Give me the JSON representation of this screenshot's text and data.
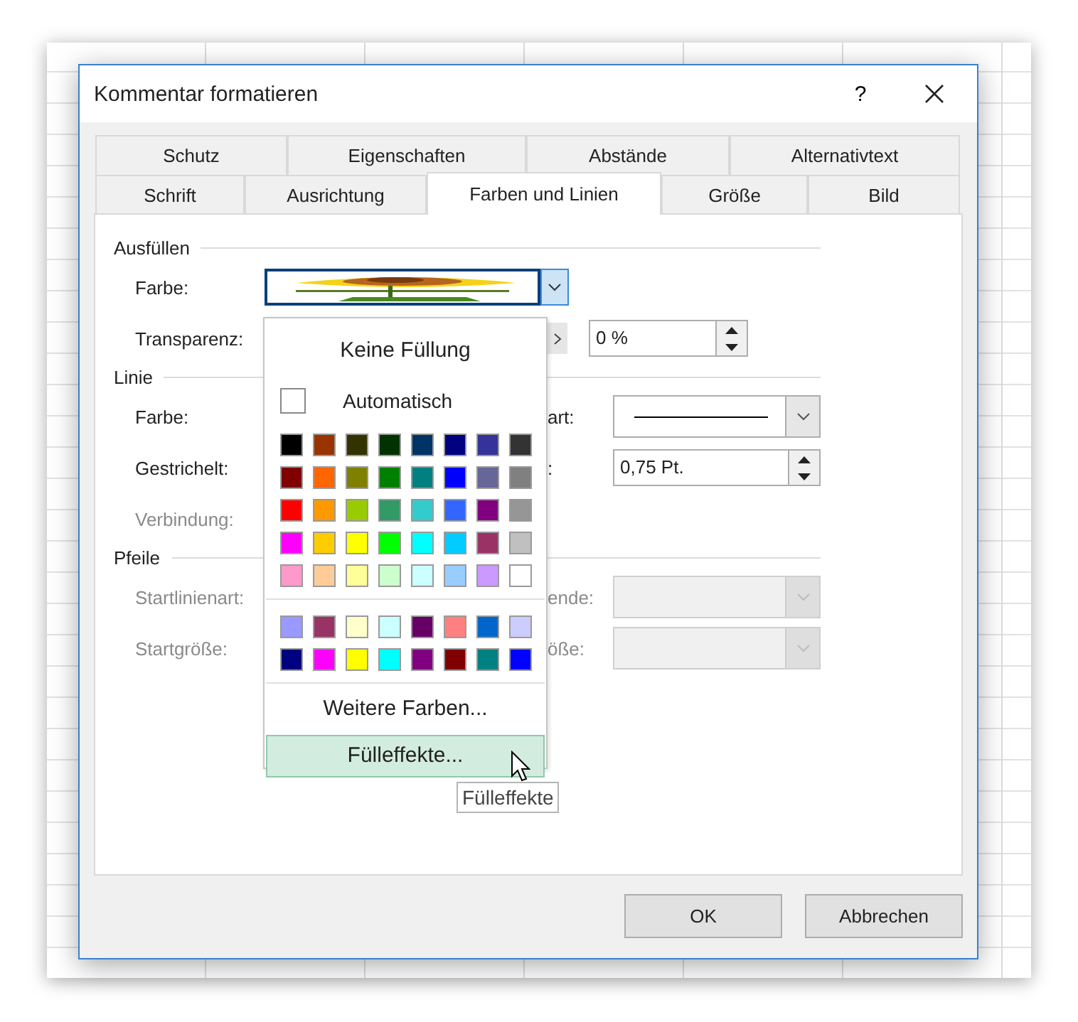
{
  "window": {
    "title": "Kommentar formatieren",
    "help": "?"
  },
  "tab_rows": [
    {
      "tabs": [
        {
          "label": "Schutz",
          "selected": false
        },
        {
          "label": "Eigenschaften",
          "selected": false
        },
        {
          "label": "Abstände",
          "selected": false
        },
        {
          "label": "Alternativtext",
          "selected": false
        }
      ]
    },
    {
      "tabs": [
        {
          "label": "Schrift",
          "selected": false
        },
        {
          "label": "Ausrichtung",
          "selected": false
        },
        {
          "label": "Farben und Linien",
          "selected": true
        },
        {
          "label": "Größe",
          "selected": false
        },
        {
          "label": "Bild",
          "selected": false
        }
      ]
    }
  ],
  "fill": {
    "heading": "Ausfüllen",
    "color_label": "Farbe:",
    "transparency_label": "Transparenz:",
    "transparency_value": "0 %"
  },
  "line": {
    "heading": "Linie",
    "color_label": "Farbe:",
    "style_label": "art:",
    "dashed_label": "Gestrichelt:",
    "weight_label": ":",
    "weight_value": "0,75 Pt.",
    "join_label": "Verbindung:",
    "join_disabled": true
  },
  "arrows": {
    "heading": "Pfeile",
    "rows": [
      {
        "left_label": "Startlinienart:",
        "right_label": "ende:",
        "disabled": true
      },
      {
        "left_label": "Startgröße:",
        "right_label": "öße:",
        "disabled": true
      }
    ]
  },
  "color_menu": {
    "no_fill": "Keine Füllung",
    "automatic": "Automatisch",
    "standard_colors": [
      {
        "color": "#000000"
      },
      {
        "color": "#993300"
      },
      {
        "color": "#333300"
      },
      {
        "color": "#003300"
      },
      {
        "color": "#003366"
      },
      {
        "color": "#000080"
      },
      {
        "color": "#333399"
      },
      {
        "color": "#333333"
      },
      {
        "color": "#800000"
      },
      {
        "color": "#ff6600"
      },
      {
        "color": "#808000"
      },
      {
        "color": "#008000"
      },
      {
        "color": "#008080"
      },
      {
        "color": "#0000ff"
      },
      {
        "color": "#666699"
      },
      {
        "color": "#808080"
      },
      {
        "color": "#ff0000"
      },
      {
        "color": "#ff9900"
      },
      {
        "color": "#99cc00"
      },
      {
        "color": "#339966"
      },
      {
        "color": "#33cccc"
      },
      {
        "color": "#3366ff"
      },
      {
        "color": "#800080"
      },
      {
        "color": "#969696"
      },
      {
        "color": "#ff00ff"
      },
      {
        "color": "#ffcc00"
      },
      {
        "color": "#ffff00"
      },
      {
        "color": "#00ff00"
      },
      {
        "color": "#00ffff"
      },
      {
        "color": "#00ccff"
      },
      {
        "color": "#993366"
      },
      {
        "color": "#c0c0c0"
      },
      {
        "color": "#ff99cc"
      },
      {
        "color": "#ffcc99"
      },
      {
        "color": "#ffff99"
      },
      {
        "color": "#ccffcc"
      },
      {
        "color": "#ccffff"
      },
      {
        "color": "#99ccff"
      },
      {
        "color": "#cc99ff"
      },
      {
        "color": "#ffffff"
      }
    ],
    "recent_colors": [
      {
        "color": "#9999ff"
      },
      {
        "color": "#993366"
      },
      {
        "color": "#ffffcc"
      },
      {
        "color": "#ccffff"
      },
      {
        "color": "#660066"
      },
      {
        "color": "#ff8080"
      },
      {
        "color": "#0066cc"
      },
      {
        "color": "#ccccff"
      },
      {
        "color": "#000080"
      },
      {
        "color": "#ff00ff"
      },
      {
        "color": "#ffff00"
      },
      {
        "color": "#00ffff"
      },
      {
        "color": "#800080"
      },
      {
        "color": "#800000"
      },
      {
        "color": "#008080"
      },
      {
        "color": "#0000ff"
      }
    ],
    "more_colors": "Weitere Farben...",
    "fill_effects": {
      "label": "Fülleffekte...",
      "selected": true
    }
  },
  "tooltip": "Fülleffekte",
  "buttons": [
    {
      "label": "OK"
    },
    {
      "label": "Abbrechen"
    }
  ]
}
